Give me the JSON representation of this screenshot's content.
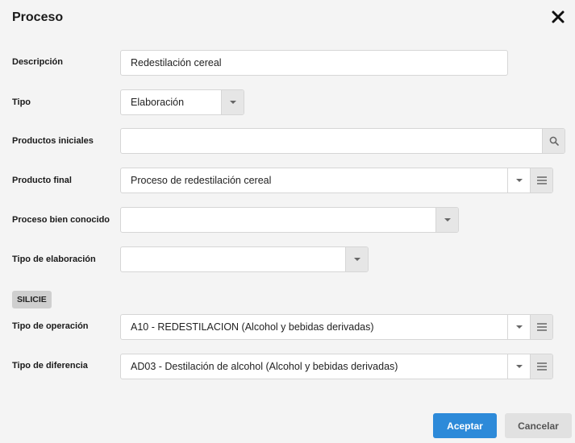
{
  "dialog": {
    "title": "Proceso",
    "close_icon": "close-icon"
  },
  "form": {
    "descripcion": {
      "label": "Descripción",
      "value": "Redestilación cereal"
    },
    "tipo": {
      "label": "Tipo",
      "value": "Elaboración"
    },
    "productos_iniciales": {
      "label": "Productos iniciales",
      "value": "",
      "icon": "search-icon"
    },
    "producto_final": {
      "label": "Producto final",
      "value": "Proceso de redestilación cereal",
      "icon": "list-icon"
    },
    "proceso_bien_conocido": {
      "label": "Proceso bien conocido",
      "value": ""
    },
    "tipo_elaboracion": {
      "label": "Tipo de elaboración",
      "value": ""
    }
  },
  "silicie": {
    "section_label": "SILICIE",
    "tipo_operacion": {
      "label": "Tipo de operación",
      "value": "A10 - REDESTILACION (Alcohol y bebidas derivadas)",
      "icon": "list-icon"
    },
    "tipo_diferencia": {
      "label": "Tipo de diferencia",
      "value": "AD03 - Destilación de alcohol (Alcohol y bebidas derivadas)",
      "icon": "list-icon"
    }
  },
  "actions": {
    "accept_label": "Aceptar",
    "cancel_label": "Cancelar"
  },
  "colors": {
    "accent": "#2d8ad9",
    "background": "#f4f4f4"
  }
}
